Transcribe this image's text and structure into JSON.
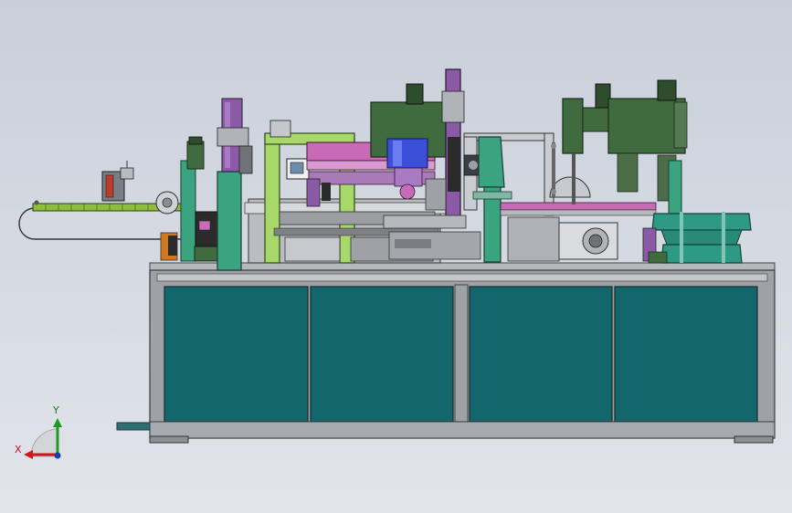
{
  "axis_triad": {
    "y_label": "Y",
    "x_label": "X",
    "colors": {
      "x": "#d01818",
      "y": "#1e9a1e",
      "z": "#1b3fa8"
    }
  },
  "palette": {
    "cabinet_frame": "#9da0a4",
    "cabinet_panel": "#12666c",
    "conveyor_green": "#8fbf3a",
    "frame_green": "#a8d86a",
    "motor_green": "#3f6b3e",
    "purple": "#8a5aa6",
    "magenta": "#c86ab6",
    "bowl_teal": "#2e9a86",
    "teal_plate": "#3aa37f"
  }
}
